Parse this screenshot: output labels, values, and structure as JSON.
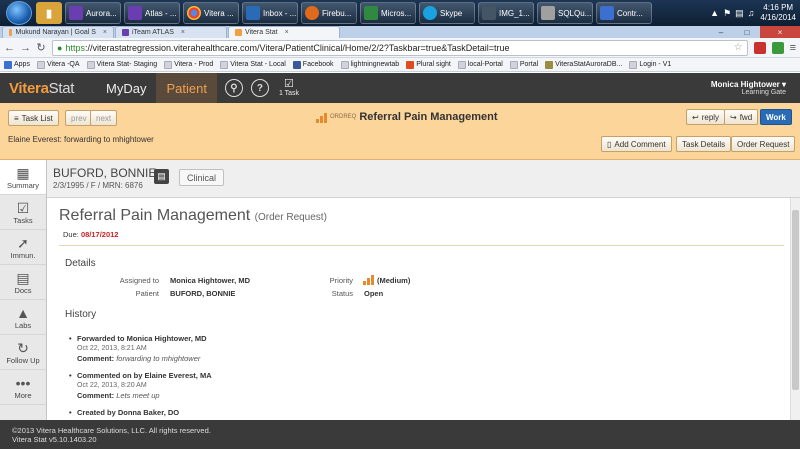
{
  "os_taskbar": {
    "buttons": [
      {
        "label": "Aurora...",
        "color": "#6a3db0"
      },
      {
        "label": "Atlas - ...",
        "color": "#6a3db0"
      },
      {
        "label": "Vitera ...",
        "color": "#3b8ad8"
      },
      {
        "label": "Inbox - ...",
        "color": "#2a6bb8"
      },
      {
        "label": "Firebu...",
        "color": "#e06a1c"
      },
      {
        "label": "Micros...",
        "color": "#2f8a3f"
      },
      {
        "label": "Skype",
        "color": "#1aa1e0"
      },
      {
        "label": "IMG_1...",
        "color": "#445566"
      },
      {
        "label": "SQLQu...",
        "color": "#a0a0a0"
      },
      {
        "label": "Contr...",
        "color": "#3b6fd0"
      }
    ],
    "clock_time": "4:16 PM",
    "clock_date": "4/16/2014"
  },
  "browser": {
    "tabs": [
      {
        "label": "Mukund Narayan | Goal S",
        "active": false
      },
      {
        "label": "iTeam ATLAS",
        "active": false
      },
      {
        "label": "Vitera Stat",
        "active": true
      }
    ],
    "url_scheme": "https",
    "url_rest": "://viterastatregression.viterahealthcare.com/Vitera/PatientClinical/Home/2/2?Taskbar=true&TaskDetail=true",
    "bookmarks": [
      "Apps",
      "Vitera -QA",
      "Vitera Stat- Staging",
      "Vitera - Prod",
      "Vitera Stat - Local",
      "Facebook",
      "lightningnewtab",
      "Plural sight",
      "local-Portal",
      "Portal",
      "ViteraStatAuroraDB...",
      "Login - V1"
    ]
  },
  "app": {
    "logo_main": "Vitera",
    "logo_suffix": "Stat",
    "nav_myday": "MyDay",
    "nav_patient": "Patient",
    "task_count": "1 Task",
    "user_name": "Monica Hightower",
    "user_location": "Learning Gate"
  },
  "task_toolbar": {
    "task_list": "Task List",
    "prev": "prev",
    "next": "next",
    "ordreq": "ORDREQ",
    "title": "Referral Pain Management",
    "reply": "reply",
    "fwd": "fwd",
    "work": "Work",
    "message": "Elaine Everest: forwarding to mhightower",
    "add_comment": "Add Comment",
    "task_details": "Task Details",
    "order_request": "Order Request"
  },
  "sidebar": {
    "items": [
      {
        "label": "Summary",
        "icon": "summary-icon"
      },
      {
        "label": "Tasks",
        "icon": "tasks-icon"
      },
      {
        "label": "Immun.",
        "icon": "syringe-icon"
      },
      {
        "label": "Docs",
        "icon": "docs-icon"
      },
      {
        "label": "Labs",
        "icon": "flask-icon"
      },
      {
        "label": "Follow Up",
        "icon": "follow-up-icon"
      },
      {
        "label": "More",
        "icon": "more-icon"
      }
    ]
  },
  "patient": {
    "name": "BUFORD, BONNIE",
    "info": "2/3/1995 / F / MRN: 6876",
    "clinical": "Clinical"
  },
  "request": {
    "title": "Referral Pain Management",
    "type": "(Order Request)",
    "due_label": "Due:",
    "due_date": "08/17/2012",
    "details_heading": "Details",
    "assigned_to_label": "Assigned to",
    "assigned_to": "Monica Hightower, MD",
    "patient_label": "Patient",
    "patient": "BUFORD, BONNIE",
    "priority_label": "Priority",
    "priority": "(Medium)",
    "status_label": "Status",
    "status": "Open",
    "history_heading": "History",
    "history": [
      {
        "head": "Forwarded to Monica Hightower, MD",
        "date": "Oct 22, 2013, 8:21 AM",
        "comment_label": "Comment:",
        "comment": "forwarding to mhightower"
      },
      {
        "head": "Commented on by Elaine Everest, MA",
        "date": "Oct 22, 2013, 8:20 AM",
        "comment_label": "Comment:",
        "comment": "Lets meet up"
      },
      {
        "head": "Created by Donna Baker, DO"
      }
    ]
  },
  "footer": {
    "copyright": "©2013 Vitera Healthcare Solutions, LLC. All rights reserved.",
    "version": "Vitera Stat v5.10.1403.20"
  },
  "colors": {
    "accent_orange": "#f39c3c",
    "toolbar_bg": "#fbd59a",
    "work_button": "#2a6bb8",
    "due_date": "#cc2222"
  }
}
